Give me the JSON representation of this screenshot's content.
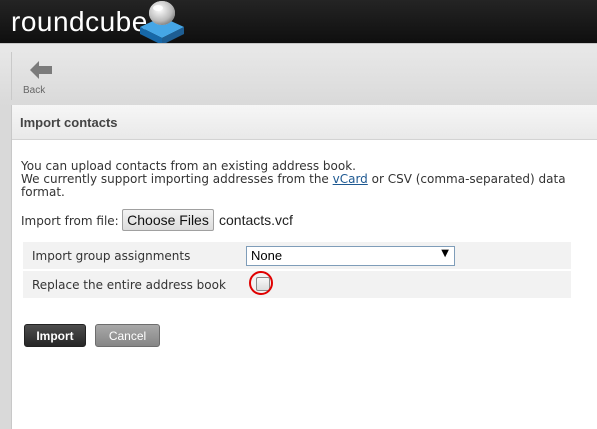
{
  "header": {
    "logo_text": "roundcube",
    "logo_icon": "roundcube-cube-icon"
  },
  "toolbar": {
    "back_label": "Back",
    "back_icon": "arrow-left-icon"
  },
  "panel": {
    "title": "Import contacts",
    "intro_line1": "You can upload contacts from an existing address book.",
    "intro_line2_prefix": "We currently support importing addresses from the ",
    "intro_link": "vCard",
    "intro_line2_suffix": " or CSV (comma-separated) data format.",
    "file_label": "Import from file:",
    "choose_button": "Choose Files",
    "file_name": "contacts.vcf",
    "group_label": "Import group assignments",
    "group_value": "None",
    "replace_label": "Replace the entire address book",
    "replace_checked": false,
    "import_button": "Import",
    "cancel_button": "Cancel"
  },
  "colors": {
    "highlight": "#e00000",
    "link": "#1d5891",
    "logo_blue": "#1e73be"
  }
}
